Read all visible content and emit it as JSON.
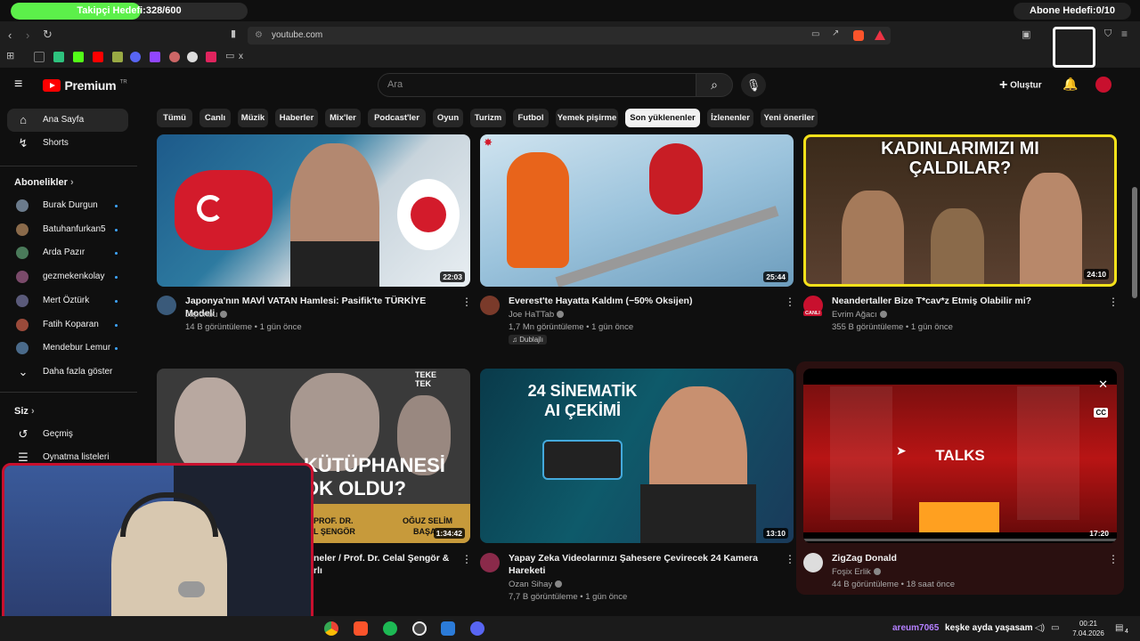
{
  "overlay": {
    "follower_goal": "Takipçi Hedefi:328/600",
    "follower_progress": 0.547,
    "subscriber_goal": "Abone Hedefi:0/10"
  },
  "browser": {
    "url": "youtube.com",
    "bookmark_extra": "x"
  },
  "header": {
    "brand": "Premium",
    "brand_sup": "TR",
    "search_placeholder": "Ara",
    "create_label": "Oluştur"
  },
  "sidebar": {
    "home": "Ana Sayfa",
    "shorts": "Shorts",
    "subs_title": "Abonelikler",
    "subscriptions": [
      {
        "name": "Burak Durgun",
        "color": "#6b7b8c"
      },
      {
        "name": "Batuhanfurkan5",
        "color": "#8a6a4a"
      },
      {
        "name": "Arda Pazır",
        "color": "#4a7a5a"
      },
      {
        "name": "gezmekenkolay",
        "color": "#7a4a6a"
      },
      {
        "name": "Mert Öztürk",
        "color": "#5a5a7a"
      },
      {
        "name": "Fatih Koparan",
        "color": "#9a4a3a"
      },
      {
        "name": "Mendebur Lemur",
        "color": "#4a6a8a"
      }
    ],
    "show_more": "Daha fazla göster",
    "you_title": "Siz",
    "history": "Geçmiş",
    "playlists": "Oynatma listeleri"
  },
  "chips": [
    {
      "label": "Tümü",
      "active": false
    },
    {
      "label": "Canlı",
      "active": false
    },
    {
      "label": "Müzik",
      "active": false
    },
    {
      "label": "Haberler",
      "active": false
    },
    {
      "label": "Mix'ler",
      "active": false
    },
    {
      "label": "Podcast'ler",
      "active": false
    },
    {
      "label": "Oyun",
      "active": false
    },
    {
      "label": "Turizm",
      "active": false
    },
    {
      "label": "Futbol",
      "active": false
    },
    {
      "label": "Yemek pişirme",
      "active": false
    },
    {
      "label": "Son yüklenenler",
      "active": true
    },
    {
      "label": "İzlenenler",
      "active": false
    },
    {
      "label": "Yeni öneriler",
      "active": false
    }
  ],
  "videos": [
    {
      "title": "Japonya'nın MAVİ VATAN Hamlesi: Pasifik'te TÜRKİYE Modeli",
      "title2": "",
      "channel": "Japonbu",
      "meta": "14 B görüntüleme • 1 gün önce",
      "duration": "22:03",
      "badge": "",
      "av_color": "#3a5a7a"
    },
    {
      "title": "Everest'te Hayatta Kaldım (−50% Oksijen)",
      "title2": "",
      "channel": "Joe HaTTab",
      "meta": "1,7 Mn görüntüleme • 1 gün önce",
      "duration": "25:44",
      "badge": "Dublajlı",
      "av_color": "#7a3a2a"
    },
    {
      "title": "Neandertaller Bize T*cav*z Etmiş Olabilir mi?",
      "title2": "",
      "channel": "Evrim Ağacı",
      "meta": "355 B görüntüleme • 1 gün önce",
      "duration": "24:10",
      "badge": "",
      "av_color": "#c8102e",
      "live": "CANLI"
    },
    {
      "title": "neler / Prof. Dr. Celal Şengör &",
      "title2": "rlı",
      "channel": "",
      "meta": "",
      "duration": "1:34:42",
      "badge": "",
      "av_color": "#555"
    },
    {
      "title": "Yapay Zeka Videolarınızı Şahesere Çevirecek 24 Kamera",
      "title2": "Hareketi",
      "channel": "Ozan Sihay",
      "meta": "7,7 B görüntüleme • 1 gün önce",
      "duration": "13:10",
      "badge": "",
      "av_color": "#8a2a4a"
    },
    {
      "title": "ZigZag Donald",
      "title2": "",
      "channel": "Foşix Erlik",
      "meta": "44 B görüntüleme • 18 saat önce",
      "duration": "17:20",
      "badge": "",
      "av_color": "#dddddd"
    }
  ],
  "thumb_text": {
    "v3_line1": "KADINLARIMIZI MI",
    "v3_line2": "ÇALDILAR?",
    "v4_line1": "KÜTÜPHANESİ",
    "v4_line2": "OK OLDU?",
    "v4_name1": "PROF. DR.",
    "v4_name1b": "L ŞENGÖR",
    "v4_name2": "OĞUZ SELİM",
    "v4_name2b": "BAŞA",
    "v4_logo": "TEKE TEK",
    "v5_line1": "24 SİNEMATİK",
    "v5_line2": "AI ÇEKİMİ",
    "v6_text": "TALKS",
    "cc": "CC"
  },
  "taskbar": {
    "chat_user": "areum7065",
    "chat_msg": "keşke ayda yaşasam",
    "time": "00:21",
    "date": "7.04.2026",
    "notif": "4"
  }
}
